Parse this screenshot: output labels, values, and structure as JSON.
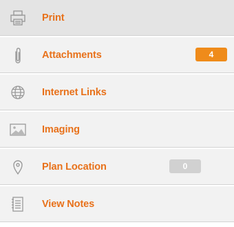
{
  "menu": {
    "items": [
      {
        "label": "Print",
        "icon": "printer-icon"
      },
      {
        "label": "Attachments",
        "icon": "paperclip-icon",
        "badge": "4",
        "badge_color": "#ef8b1a"
      },
      {
        "label": "Internet Links",
        "icon": "globe-icon"
      },
      {
        "label": "Imaging",
        "icon": "image-icon"
      },
      {
        "label": "Plan Location",
        "icon": "location-pin-icon",
        "badge": "0",
        "badge_color": "#d1d1d1"
      },
      {
        "label": "View Notes",
        "icon": "notes-icon"
      }
    ]
  },
  "colors": {
    "label": "#e8711a",
    "icon": "#9a9a9a",
    "row_background": "#f2f2f2",
    "highlight_row_background": "#e4e4e4",
    "divider": "#d3d3d3"
  }
}
